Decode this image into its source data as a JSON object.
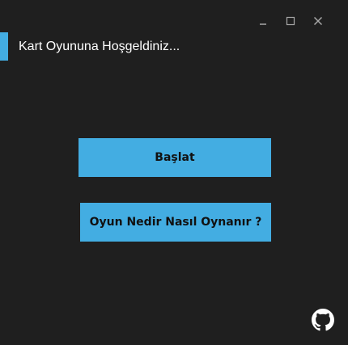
{
  "window": {
    "title": "Kart Oyununa Hoşgeldiniz...",
    "controls": {
      "minimize": "minimize-icon",
      "maximize": "maximize-icon",
      "close": "close-icon"
    }
  },
  "main": {
    "start_label": "Başlat",
    "help_label": "Oyun Nedir Nasıl Oynanır ?"
  },
  "footer": {
    "icon": "github-icon"
  },
  "colors": {
    "background": "#1f1f1f",
    "accent": "#43ade2",
    "text": "#ffffff",
    "button_text": "#111111"
  }
}
